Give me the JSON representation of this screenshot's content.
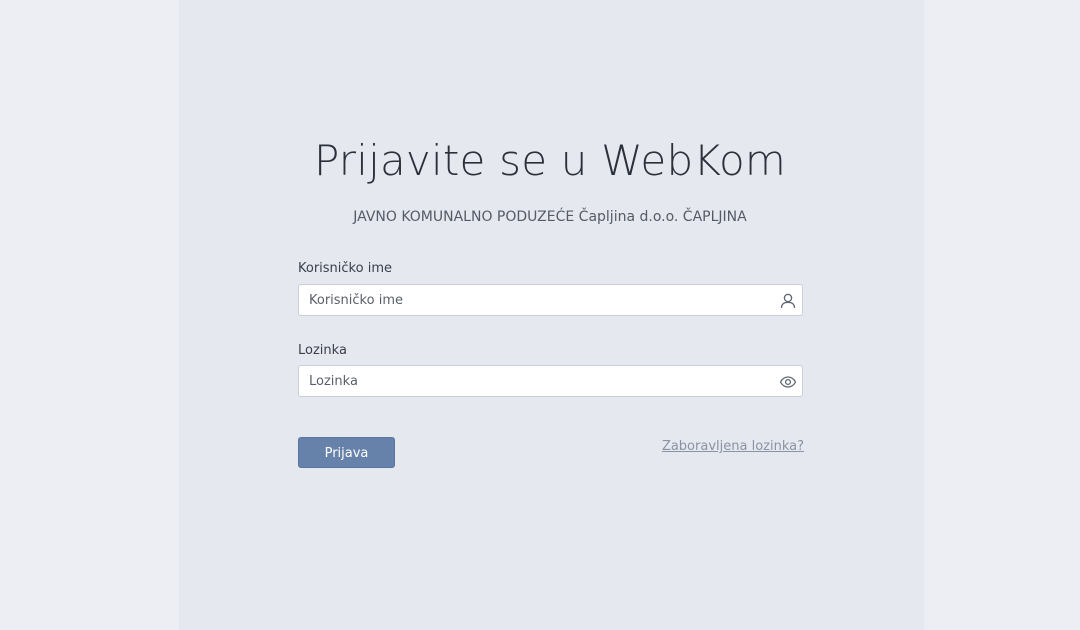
{
  "header": {
    "title": "Prijavite se u WebKom",
    "subtitle": "JAVNO KOMUNALNO PODUZEĆE Čapljina d.o.o. ČAPLJINA"
  },
  "form": {
    "username": {
      "label": "Korisničko ime",
      "placeholder": "Korisničko ime",
      "value": "",
      "icon": "user-icon"
    },
    "password": {
      "label": "Lozinka",
      "placeholder": "Lozinka",
      "value": "",
      "icon": "eye-icon"
    },
    "submit_label": "Prijava",
    "forgot_label": "Zaboravljena lozinka?"
  },
  "colors": {
    "button": "#6682aa",
    "panel": "#e5e8ef",
    "background": "#eceef3"
  }
}
